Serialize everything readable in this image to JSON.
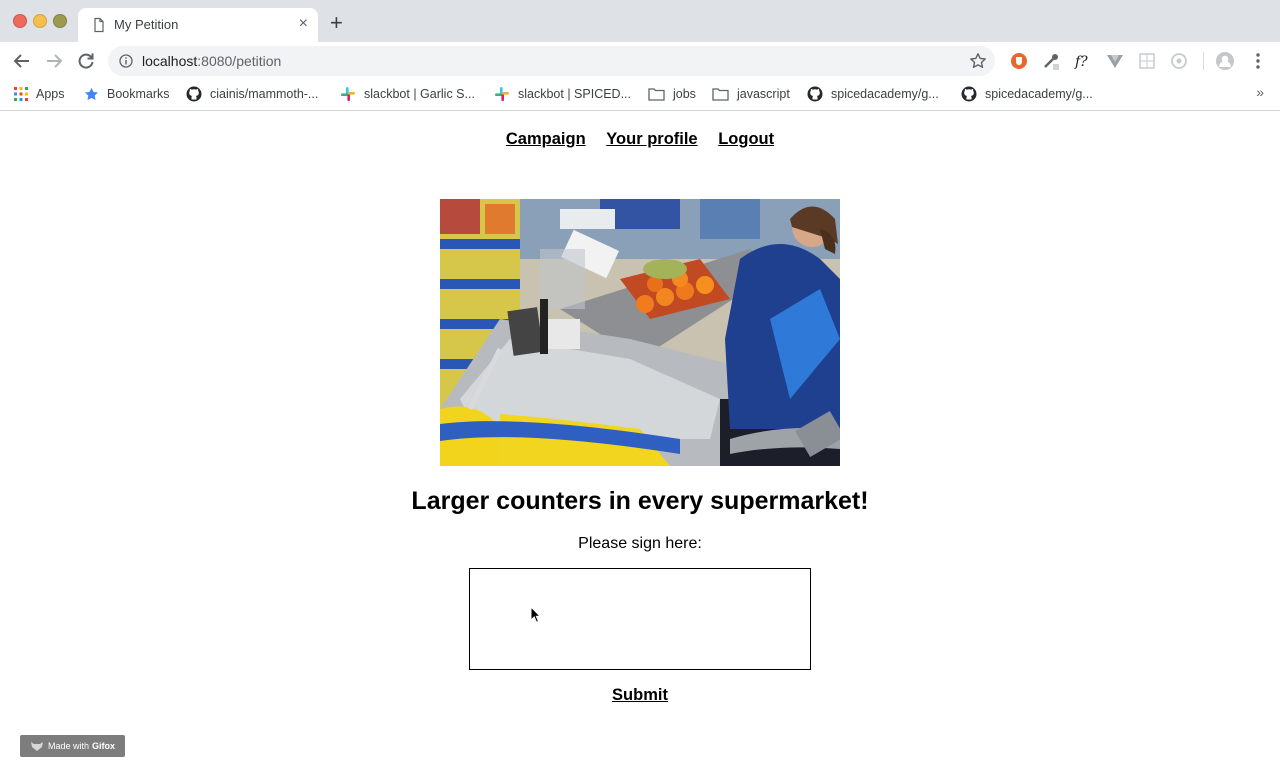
{
  "browser": {
    "tab_title": "My Petition",
    "tab_close": "×",
    "new_tab": "+",
    "url_host": "localhost",
    "url_rest": ":8080/petition",
    "bookmarks": [
      {
        "label": "Apps",
        "icon": "apps-grid-icon"
      },
      {
        "label": "Bookmarks",
        "icon": "star-icon"
      },
      {
        "label": "ciainis/mammoth-...",
        "icon": "github-icon"
      },
      {
        "label": "slackbot | Garlic S...",
        "icon": "slack-icon"
      },
      {
        "label": "slackbot | SPICED...",
        "icon": "slack-icon"
      },
      {
        "label": "jobs",
        "icon": "folder-icon"
      },
      {
        "label": "javascript",
        "icon": "folder-icon"
      },
      {
        "label": "spicedacademy/g...",
        "icon": "github-icon"
      },
      {
        "label": "spicedacademy/g...",
        "icon": "github-icon"
      }
    ],
    "bookmarks_overflow": "»"
  },
  "nav": {
    "campaign": "Campaign",
    "profile": "Your profile",
    "logout": "Logout"
  },
  "petition": {
    "title": "Larger counters in every supermarket!",
    "sign_label": "Please sign here:",
    "submit": "Submit"
  },
  "watermark": {
    "prefix": "Made with",
    "brand": "Gifox"
  },
  "colors": {
    "tabstrip": "#dee1e6",
    "omnibox": "#f1f3f4",
    "close_red": "#ed6a5e",
    "minimize_yellow": "#f5bf4f",
    "maximize_green": "#9c9a4e"
  }
}
